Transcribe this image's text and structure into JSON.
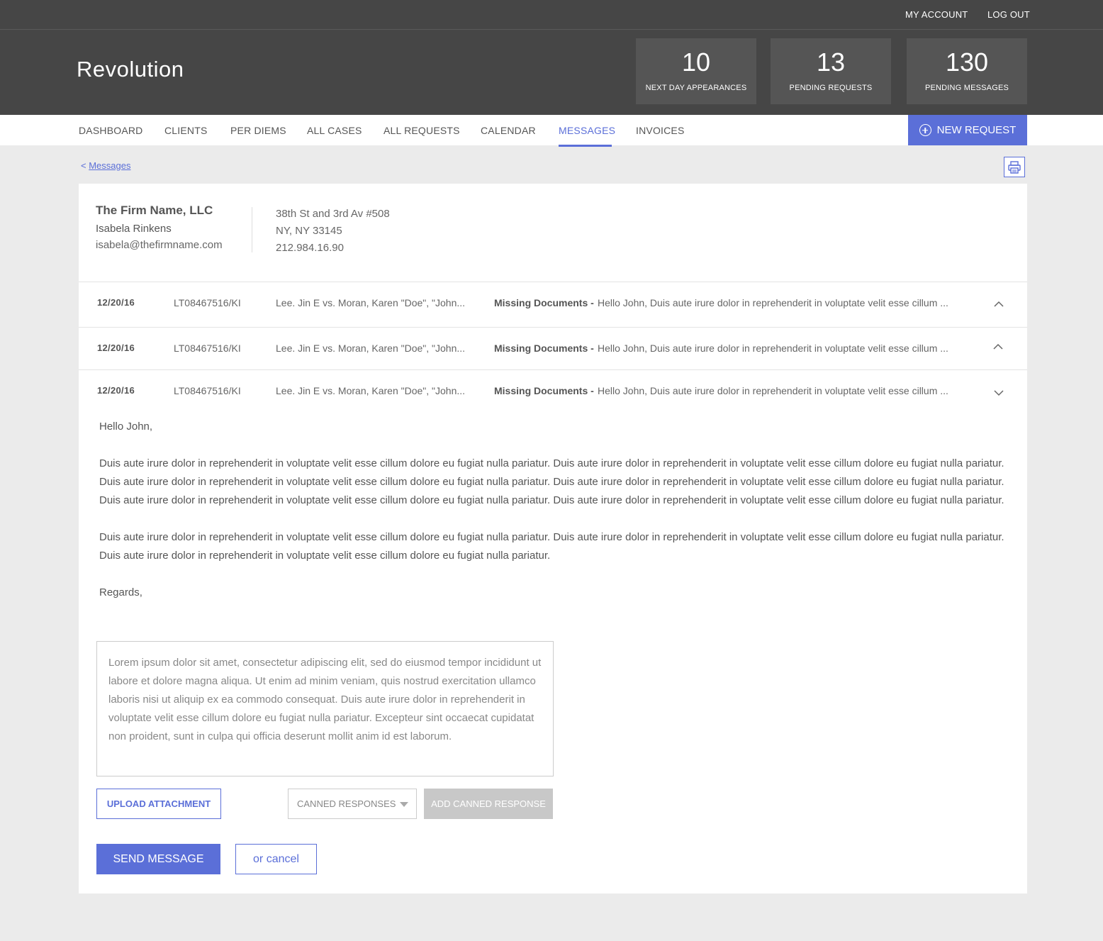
{
  "topbar": {
    "my_account": "MY ACCOUNT",
    "log_out": "LOG OUT"
  },
  "header": {
    "brand": "Revolution",
    "stats": [
      {
        "value": "10",
        "label": "NEXT DAY APPEARANCES"
      },
      {
        "value": "13",
        "label": "PENDING REQUESTS"
      },
      {
        "value": "130",
        "label": "PENDING MESSAGES"
      }
    ]
  },
  "nav": {
    "items": [
      "DASHBOARD",
      "CLIENTS",
      "PER DIEMS",
      "ALL CASES",
      "ALL REQUESTS",
      "CALENDAR",
      "MESSAGES",
      "INVOICES"
    ],
    "active": "MESSAGES",
    "new_request": "NEW REQUEST"
  },
  "breadcrumb": {
    "prefix": "<",
    "label": "Messages"
  },
  "contact": {
    "firm": "The Firm Name, LLC",
    "person": "Isabela Rinkens",
    "email": "isabela@thefirmname.com",
    "address_1": "38th St and 3rd Av #508",
    "address_2": "NY, NY 33145",
    "phone": "212.984.16.90"
  },
  "messages": [
    {
      "date": "12/20/16",
      "case": "LT08467516/KI",
      "parties": "Lee. Jin E vs. Moran, Karen \"Doe\", \"John...",
      "subject": "Missing Documents -",
      "preview": "Hello John, Duis aute irure dolor in reprehenderit in voluptate velit esse cillum ...",
      "chevron": "chevron-up-icon"
    },
    {
      "date": "12/20/16",
      "case": "LT08467516/KI",
      "parties": "Lee. Jin E vs. Moran, Karen \"Doe\", \"John...",
      "subject": "Missing Documents -",
      "preview": "Hello John, Duis aute irure dolor in reprehenderit in voluptate velit esse cillum ...",
      "chevron": "chevron-up-icon"
    },
    {
      "date": "12/20/16",
      "case": "LT08467516/KI",
      "parties": "Lee. Jin E vs. Moran, Karen \"Doe\", \"John...",
      "subject": "Missing Documents -",
      "preview": "Hello John, Duis aute irure dolor in reprehenderit in voluptate velit esse cillum ...",
      "chevron": "chevron-down-icon"
    }
  ],
  "expanded_message": {
    "greeting": "Hello John,",
    "paragraph_1": "Duis aute irure dolor in reprehenderit in voluptate velit esse cillum dolore eu fugiat nulla pariatur. Duis aute irure dolor in reprehenderit in voluptate velit esse cillum dolore eu fugiat nulla pariatur. Duis aute irure dolor in reprehenderit in voluptate velit esse cillum dolore eu fugiat nulla pariatur. Duis aute irure dolor in reprehenderit in voluptate velit esse cillum dolore eu fugiat nulla pariatur. Duis aute irure dolor in reprehenderit in voluptate velit esse cillum dolore eu fugiat nulla pariatur. Duis aute irure dolor in reprehenderit in voluptate velit esse cillum dolore eu fugiat nulla pariatur.",
    "paragraph_2": "Duis aute irure dolor in reprehenderit in voluptate velit esse cillum dolore eu fugiat nulla pariatur. Duis aute irure dolor in reprehenderit in voluptate velit esse cillum dolore eu fugiat nulla pariatur. Duis aute irure dolor in reprehenderit in voluptate velit esse cillum dolore eu fugiat nulla pariatur.",
    "closing": "Regards,"
  },
  "reply": {
    "text": "Lorem ipsum dolor sit amet, consectetur adipiscing elit, sed do eiusmod tempor incididunt ut labore et dolore magna aliqua. Ut enim ad minim veniam, quis nostrud exercitation ullamco laboris nisi ut aliquip ex ea commodo consequat. Duis aute irure dolor in reprehenderit in voluptate velit esse cillum dolore eu fugiat nulla pariatur. Excepteur sint occaecat cupidatat non proident, sunt in culpa qui officia deserunt mollit anim id est laborum."
  },
  "actions": {
    "upload": "UPLOAD ATTACHMENT",
    "canned": "CANNED RESPONSES",
    "add_canned": "ADD CANNED RESPONSE",
    "send": "SEND MESSAGE",
    "cancel": "or cancel"
  },
  "colors": {
    "accent": "#5b6fd8",
    "header_bg": "#464646",
    "stat_bg": "#555555",
    "page_bg": "#ebebeb"
  }
}
